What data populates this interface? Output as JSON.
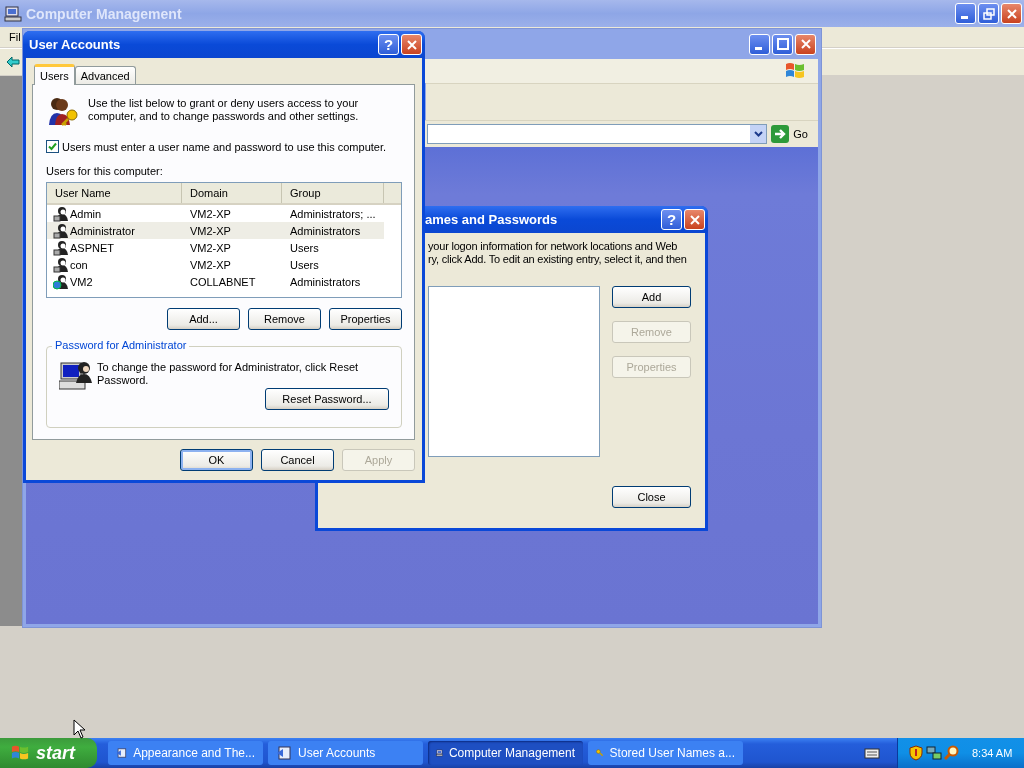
{
  "background_window": {
    "title": "Computer Management",
    "menu": [
      "Fil"
    ]
  },
  "control_panel_window": {
    "go_label": "Go"
  },
  "stored_credentials_dialog": {
    "title": "ames and Passwords",
    "help_glyph": "?",
    "description_lines": [
      "your logon information for network locations and Web",
      "ry, click Add. To edit an existing entry, select it, and then"
    ],
    "side_buttons": [
      {
        "label": "Add",
        "disabled": false
      },
      {
        "label": "Remove",
        "disabled": true
      },
      {
        "label": "Properties",
        "disabled": true
      }
    ],
    "close_button": {
      "label": "Close",
      "disabled": false
    }
  },
  "user_accounts_dialog": {
    "title": "User Accounts",
    "help_glyph": "?",
    "tabs": [
      {
        "label": "Users",
        "selected": true
      },
      {
        "label": "Advanced",
        "selected": false
      }
    ],
    "intro": "Use the list below to grant or deny users access to your computer, and to change passwords and other settings.",
    "require_password": {
      "label": "Users must enter a user name and password to use this computer.",
      "checked": true
    },
    "list_label": "Users for this computer:",
    "columns": [
      "User Name",
      "Domain",
      "Group"
    ],
    "rows": [
      {
        "user_name": "Admin",
        "domain": "VM2-XP",
        "group": "Administrators; ...",
        "kind": "local",
        "selected": false
      },
      {
        "user_name": "Administrator",
        "domain": "VM2-XP",
        "group": "Administrators",
        "kind": "local",
        "selected": true
      },
      {
        "user_name": "ASPNET",
        "domain": "VM2-XP",
        "group": "Users",
        "kind": "local",
        "selected": false
      },
      {
        "user_name": "con",
        "domain": "VM2-XP",
        "group": "Users",
        "kind": "local",
        "selected": false
      },
      {
        "user_name": "VM2",
        "domain": "COLLABNET",
        "group": "Administrators",
        "kind": "domain",
        "selected": false
      }
    ],
    "list_buttons": [
      {
        "label": "Add...",
        "disabled": false
      },
      {
        "label": "Remove",
        "disabled": false
      },
      {
        "label": "Properties",
        "disabled": false
      }
    ],
    "password_group": {
      "title": "Password for Administrator",
      "text": "To change the password for Administrator, click Reset Password.",
      "button": "Reset Password..."
    },
    "buttons": [
      {
        "label": "OK",
        "default": true,
        "disabled": false
      },
      {
        "label": "Cancel",
        "default": false,
        "disabled": false
      },
      {
        "label": "Apply",
        "default": false,
        "disabled": true
      }
    ]
  },
  "taskbar": {
    "start": "start",
    "tasks": [
      {
        "label": "Appearance and The...",
        "kind": "control",
        "selected": false
      },
      {
        "label": "User Accounts",
        "kind": "control",
        "selected": false
      },
      {
        "label": "Computer Management",
        "kind": "computer",
        "selected": true
      },
      {
        "label": "Stored User Names a...",
        "kind": "key",
        "selected": false
      }
    ],
    "clock": "8:34 AM"
  }
}
